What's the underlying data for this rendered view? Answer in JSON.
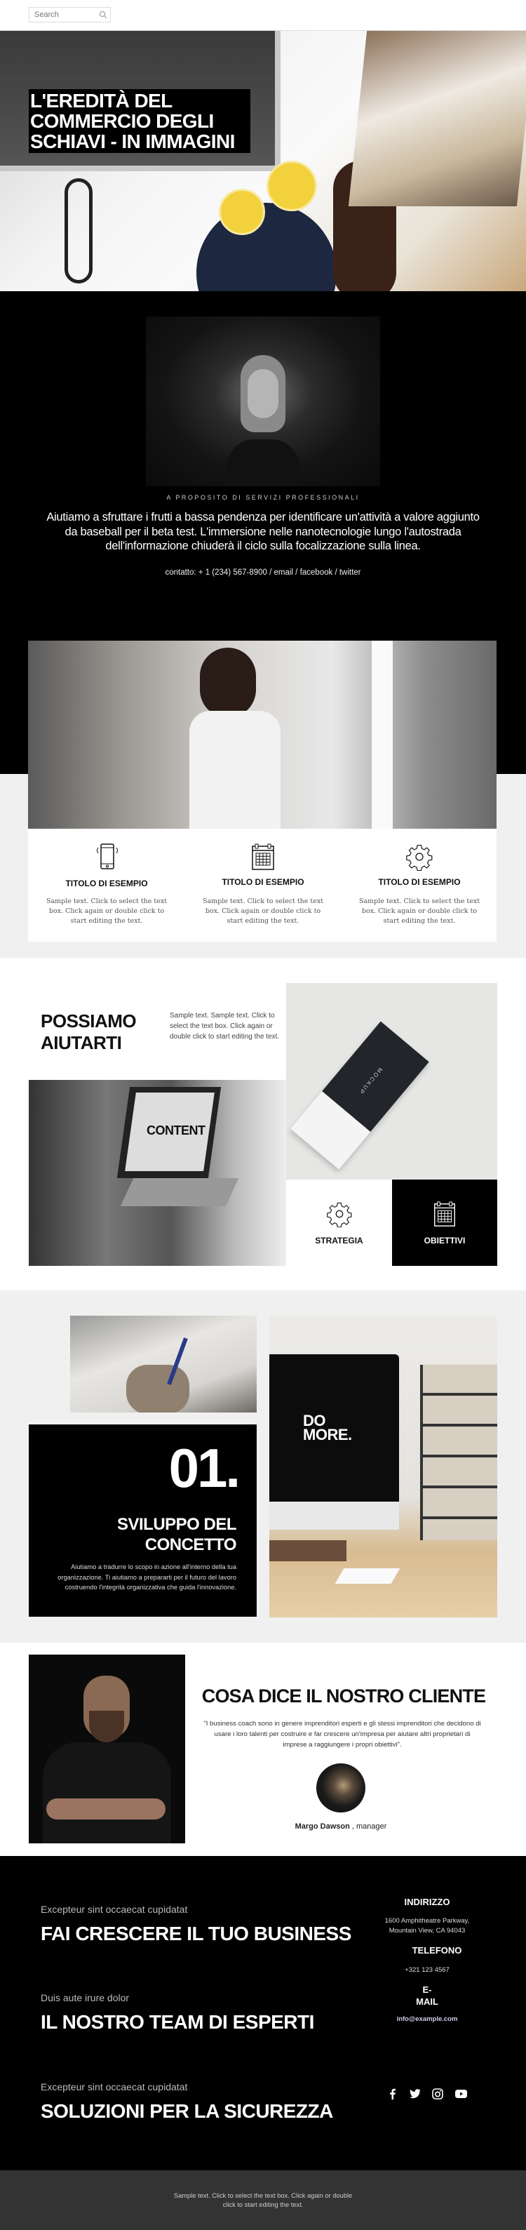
{
  "header": {
    "search_placeholder": "Search",
    "search_icon": "search-icon"
  },
  "hero": {
    "title": "L'EREDITÀ DEL COMMERCIO DEGLI SCHIAVI - IN IMMAGINI"
  },
  "about": {
    "caption": "A PROPOSITO DI SERVIZI PROFESSIONALI",
    "text": "Aiutiamo a sfruttare i frutti a bassa pendenza per identificare un'attività a valore aggiunto da baseball per il beta test. L'immersione nelle nanotecnologie lungo l'autostrada dell'informazione chiuderà il ciclo sulla focalizzazione sulla linea.",
    "contact": "contatto: + 1 (234) 567-8900 / email / facebook / twitter"
  },
  "features": [
    {
      "icon": "smartphone-icon",
      "title": "TITOLO DI ESEMPIO",
      "text": "Sample text. Click to select the text box. Click again or double click to start editing the text."
    },
    {
      "icon": "calendar-icon",
      "title": "TITOLO DI ESEMPIO",
      "text": "Sample text. Click to select the text box. Click again or double click to start editing the text."
    },
    {
      "icon": "gear-icon",
      "title": "TITOLO DI ESEMPIO",
      "text": "Sample text. Click to select the text box. Click again or double click to start editing the text."
    }
  ],
  "help": {
    "title": "POSSIAMO AIUTARTI",
    "text": "Sample text. Sample text. Click to select the text box. Click again or double click to start editing the text.",
    "strategy": "STRATEGIA",
    "goals": "OBIETTIVI",
    "laptop_screen": "CONTENT",
    "tag_text": "MOCKUP"
  },
  "concept": {
    "number": "01.",
    "title": "SVILUPPO DEL CONCETTO",
    "text": "Aiutiamo a tradurre lo scopo in azione all'interno della tua organizzazione. Ti aiutiamo a prepararti per il futuro del lavoro costruendo l'integrità organizzativa che guida l'innovazione.",
    "screen_text": "DO MORE."
  },
  "testimonial": {
    "title": "COSA DICE IL NOSTRO CLIENTE",
    "quote": "\"I business coach sono in genere imprenditori esperti e gli stessi imprenditori che decidono di usare i loro talenti per costruire e far crescere un'impresa per aiutare altri proprietari di imprese a raggiungere i propri obiettivi\".",
    "name": "Margo Dawson",
    "role": ", manager"
  },
  "footer": {
    "items": [
      {
        "sub": "Excepteur sint occaecat cupidatat",
        "title": "FAI CRESCERE IL TUO BUSINESS"
      },
      {
        "sub": "Duis aute irure dolor",
        "title": "IL NOSTRO TEAM DI ESPERTI"
      },
      {
        "sub": "Excepteur sint occaecat cupidatat",
        "title": "SOLUZIONI PER LA SICUREZZA"
      }
    ],
    "address_label": "INDIRIZZO",
    "address_line1": "1600 Amphitheatre Parkway,",
    "address_line2": "Mountain View, CA 94043",
    "phone_label": "TELEFONO",
    "phone": "+321 123 4567",
    "email_label_1": "E-",
    "email_label_2": "MAIL",
    "email": "info@example.com",
    "social": [
      "facebook-icon",
      "twitter-icon",
      "instagram-icon",
      "youtube-icon"
    ],
    "bottom_text": "Sample text. Click to select the text box. Click again or double click to start editing the text."
  },
  "colors": {
    "black": "#000000",
    "light_gray": "#f0f0f0",
    "footer_bottom": "#333333"
  }
}
